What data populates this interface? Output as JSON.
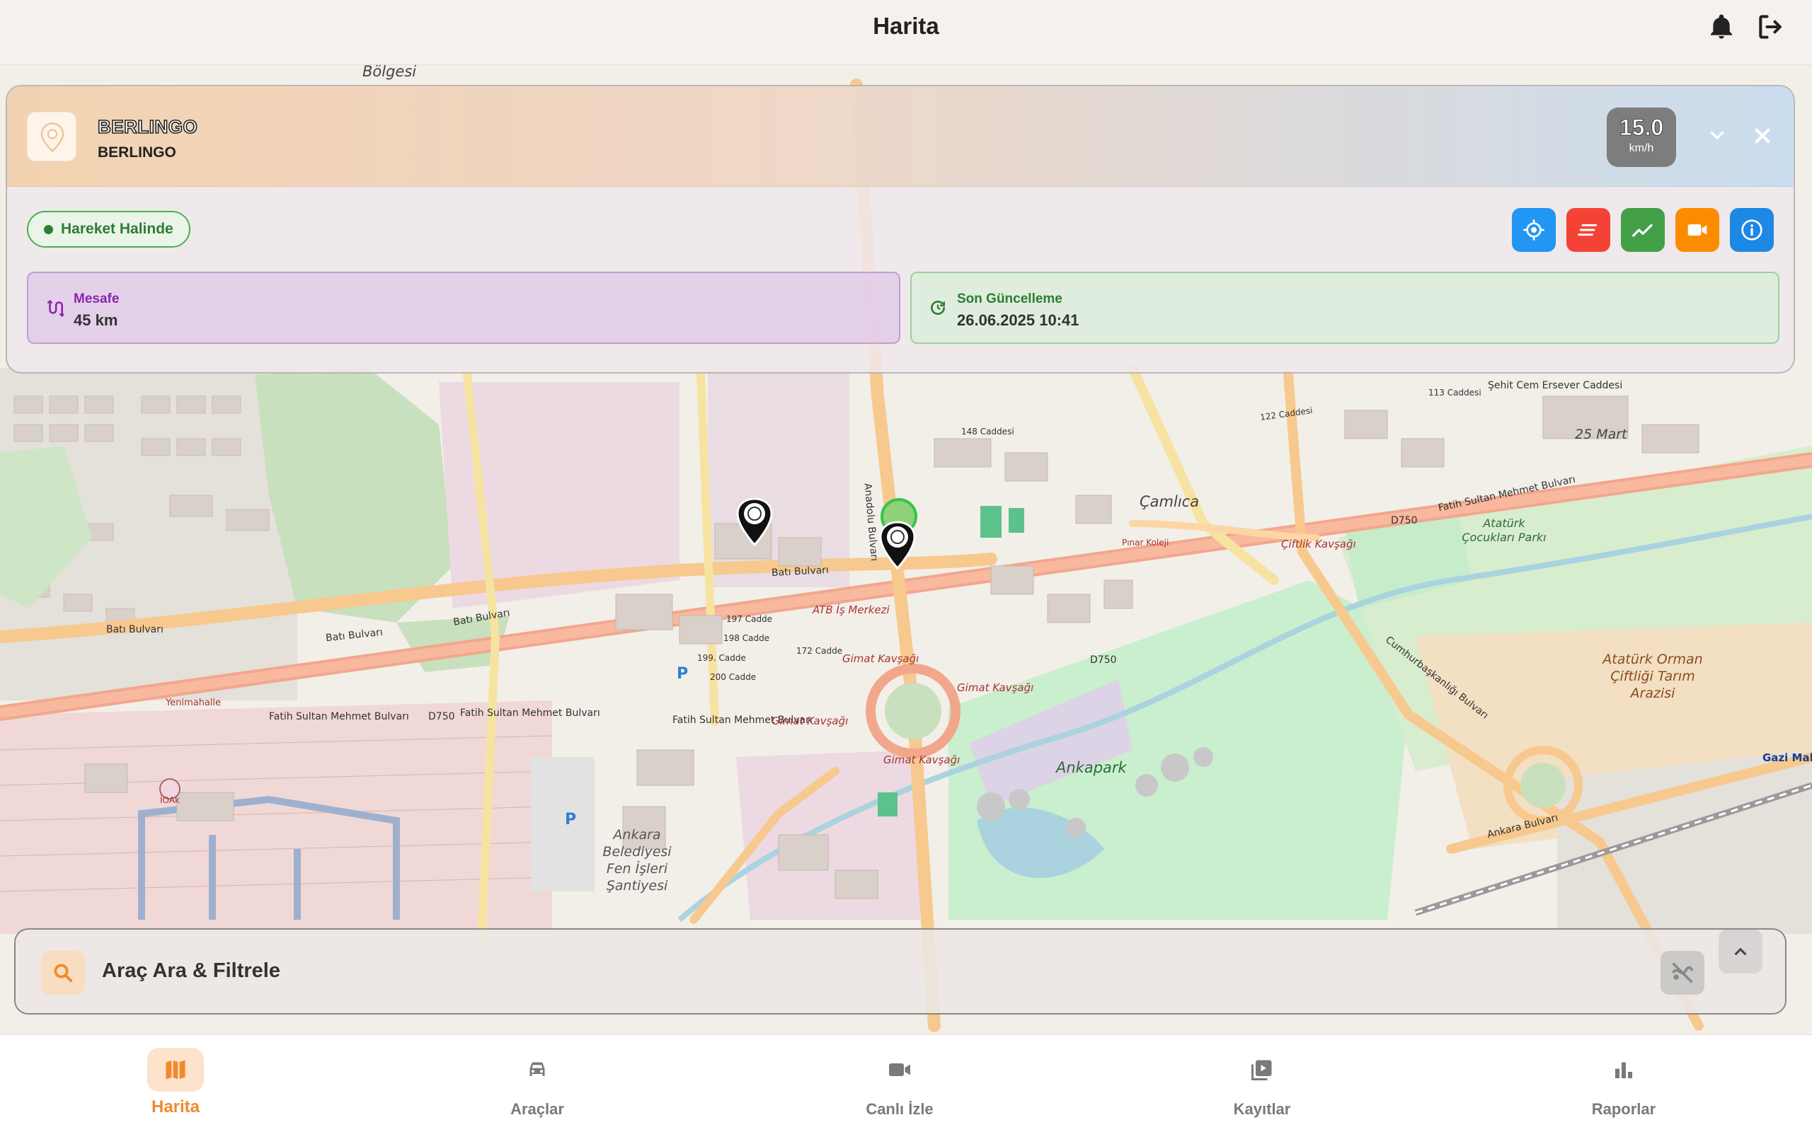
{
  "app": {
    "title": "Harita"
  },
  "header": {
    "icons": [
      "bell-icon",
      "logout-icon"
    ]
  },
  "vehicle": {
    "name": "BERLINGO",
    "subtitle": "BERLINGO",
    "speed": "15.0",
    "speed_unit": "km/h",
    "status": "Hareket Halinde",
    "distance_label": "Mesafe",
    "distance_value": "45 km",
    "update_label": "Son Güncelleme",
    "update_value": "26.06.2025 10:41",
    "actions": [
      {
        "name": "locate",
        "color": "#2196f3",
        "icon": "crosshair-icon"
      },
      {
        "name": "history",
        "color": "#f44336",
        "icon": "lines-icon"
      },
      {
        "name": "chart",
        "color": "#43a047",
        "icon": "trend-icon"
      },
      {
        "name": "camera",
        "color": "#fb8c00",
        "icon": "video-icon"
      },
      {
        "name": "info",
        "color": "#1e88e5",
        "icon": "info-icon"
      }
    ]
  },
  "search": {
    "label": "Araç Ara & Filtrele"
  },
  "nav": [
    {
      "label": "Harita",
      "icon": "map-icon",
      "active": true
    },
    {
      "label": "Araçlar",
      "icon": "car-icon",
      "active": false
    },
    {
      "label": "Canlı İzle",
      "icon": "videocam-icon",
      "active": false
    },
    {
      "label": "Kayıtlar",
      "icon": "playlist-icon",
      "active": false
    },
    {
      "label": "Raporlar",
      "icon": "bar-chart-icon",
      "active": false
    }
  ],
  "map": {
    "labels": {
      "bolgesi": "Bölgesi",
      "batibulvari1": "Batı Bulvarı",
      "batibulvari2": "Batı Bulvarı",
      "batibulvari3": "Batı Bulvarı",
      "batibulvari4": "Batı Bulvarı",
      "fsm1": "Fatih Sultan Mehmet Bulvarı",
      "fsm2": "Fatih Sultan Mehmet Bulvarı",
      "fsm3": "Fatih Sultan Mehmet Bulvarı",
      "fsm4": "Fatih Sultan Mehmet Bulvarı",
      "d750a": "D750",
      "d750b": "D750",
      "d750c": "D750",
      "anadolu": "Anadolu Bulvarı",
      "camlica": "Çamlıca",
      "ankapark": "Ankapark",
      "ataturkpark": "Atatürk Çocukları Parkı",
      "ataturkorman": "Atatürk Orman Çiftliği Tarım Arazisi",
      "belediye": "Ankara Belediyesi Fen İşleri Şantiyesi",
      "ciftlik": "Çiftlik Kavşağı",
      "gimat1": "Gimat Kavşağı",
      "gimat2": "Gimat Kavşağı",
      "gimat3": "Gimat Kavşağı",
      "gimat4": "Gimat Kavşağı",
      "sehitcem": "Şehit Cem Ersever Caddesi",
      "mart25": "25 Mart",
      "cumhur": "Cumhurbaşkanlığı Bulvarı",
      "ankarabulv": "Ankara Bulvarı",
      "atib": "ATB İş Merkezi",
      "caddesi148": "148 Caddesi",
      "caddesi122": "122 Caddesi",
      "caddesi113": "113 Caddesi",
      "caddesi172": "172 Cadde",
      "caddesi200": "200 Cadde",
      "caddesi199": "199. Cadde",
      "caddesi198": "198 Cadde",
      "caddesi197": "197 Cadde",
      "pinar": "Pınar Koleji",
      "pin_park1": "P",
      "pin_park2": "P",
      "gazi": "Gazi Maha",
      "yenimahalle": "Yenimahalle",
      "iolak": "İOAk"
    }
  }
}
